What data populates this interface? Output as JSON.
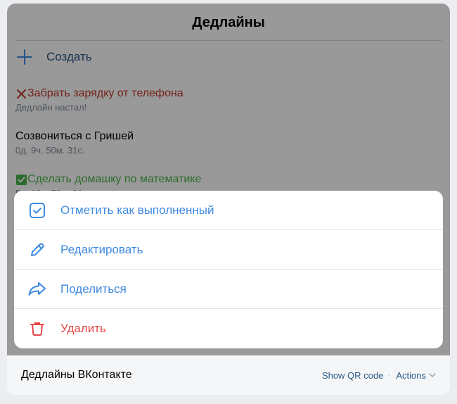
{
  "app": {
    "title": "Дедлайны",
    "create_label": "Создать",
    "deadlines": [
      {
        "title": "Забрать зарядку от телефона",
        "subtitle": "Дедлайн настал!",
        "status": "overdue",
        "color": "#c0392b"
      },
      {
        "title": "Созвониться с Гришей",
        "subtitle": "0д. 9ч. 50м. 31с.",
        "status": "pending",
        "color": "#000000"
      },
      {
        "title": "Сделать домашку по математике",
        "subtitle": "5д. 10ч. 50м. 31с.",
        "status": "done",
        "color": "#4bb34b"
      }
    ]
  },
  "action_sheet": {
    "items": [
      {
        "label": "Отметить как выполненный",
        "icon": "check-square-icon"
      },
      {
        "label": "Редактировать",
        "icon": "pencil-icon"
      },
      {
        "label": "Поделиться",
        "icon": "share-arrow-icon"
      },
      {
        "label": "Удалить",
        "icon": "trash-icon"
      }
    ]
  },
  "footer": {
    "app_name": "Дедлайны ВКонтакте",
    "qr_label": "Show QR code",
    "separator": "·",
    "actions_label": "Actions"
  },
  "colors": {
    "accent": "#3f8ae0",
    "danger": "#e64646",
    "link": "#2a5885"
  }
}
